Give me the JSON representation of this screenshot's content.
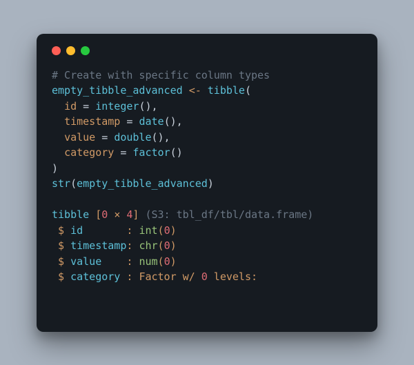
{
  "code": {
    "comment": "# Create with specific column types",
    "var": "empty_tibble_advanced",
    "assign": "<-",
    "tibble_fn": "tibble",
    "args": {
      "id": "id",
      "id_fn": "integer",
      "timestamp": "timestamp",
      "timestamp_fn": "date",
      "value": "value",
      "value_fn": "double",
      "category": "category",
      "category_fn": "factor"
    },
    "str_fn": "str",
    "str_arg": "empty_tibble_advanced"
  },
  "output": {
    "tibble": "tibble",
    "dim_open": "[",
    "rows": "0",
    "times": "×",
    "cols": "4",
    "dim_close": "]",
    "s3": "(S3: tbl_df/tbl/data.frame)",
    "dollar": " $ ",
    "id_lbl": "id       ",
    "timestamp_lbl": "timestamp",
    "value_lbl": "value    ",
    "category_lbl": "category ",
    "colon": ": ",
    "int": "int",
    "chr": "chr",
    "num": "num",
    "zero": "0",
    "factor": "Factor w/ ",
    "levels": " levels:"
  }
}
